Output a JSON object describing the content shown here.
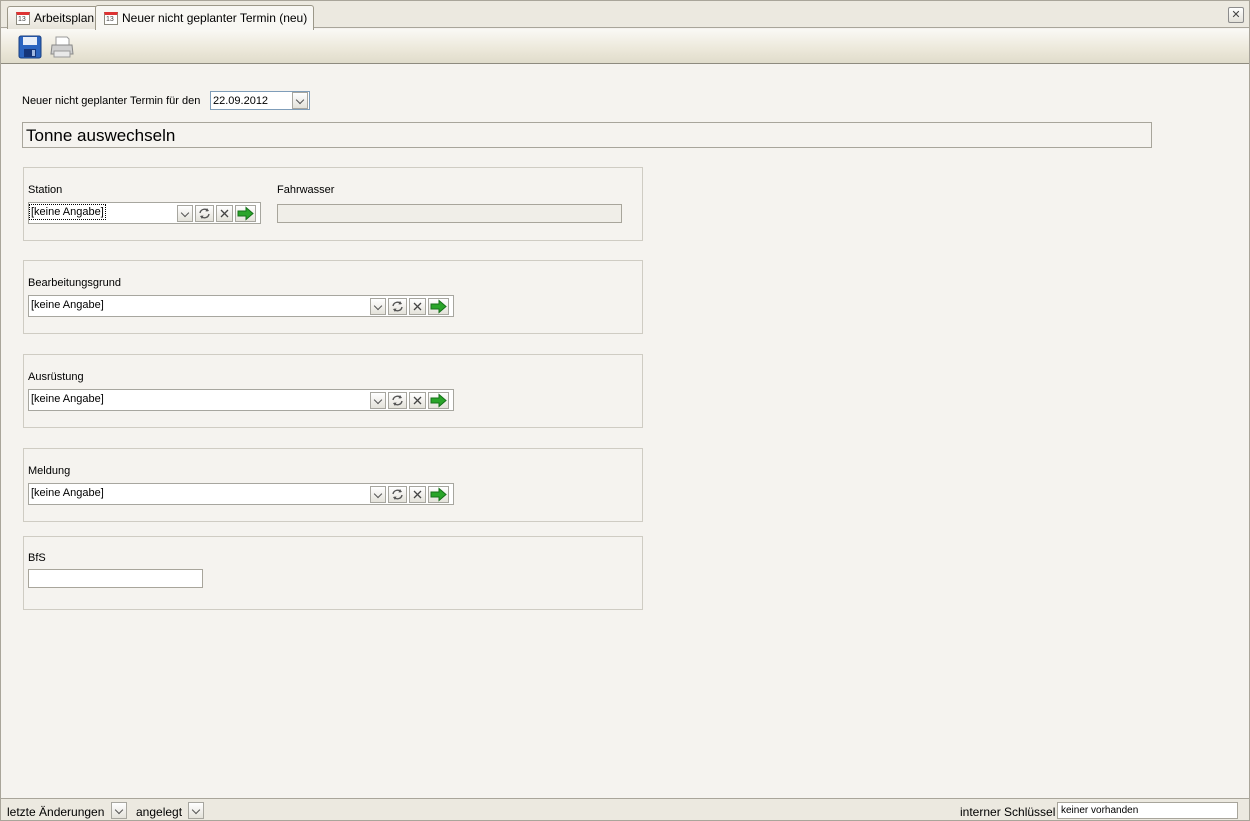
{
  "tabs": [
    {
      "label": "Arbeitsplan",
      "icon": "calendar-icon"
    },
    {
      "label": "Neuer nicht geplanter Termin (neu)",
      "icon": "calendar-icon"
    }
  ],
  "toolbar": {
    "save_icon": "save-icon",
    "print_icon": "printer-icon"
  },
  "form": {
    "date_label": "Neuer nicht geplanter Termin für den",
    "date_value": "22.09.2012",
    "title": "Tonne auswechseln",
    "station": {
      "label": "Station",
      "value": "[keine Angabe]"
    },
    "fahrwasser": {
      "label": "Fahrwasser",
      "value": ""
    },
    "bearbeitungsgrund": {
      "label": "Bearbeitungsgrund",
      "value": "[keine Angabe]"
    },
    "ausruestung": {
      "label": "Ausrüstung",
      "value": "[keine Angabe]"
    },
    "meldung": {
      "label": "Meldung",
      "value": "[keine Angabe]"
    },
    "bfs": {
      "label": "BfS",
      "value": ""
    }
  },
  "statusbar": {
    "last_changes_label": "letzte Änderungen",
    "created_label": "angelegt",
    "internal_key_label": "interner Schlüssel",
    "internal_key_value": "keiner vorhanden"
  },
  "colors": {
    "accent_green": "#2aa52a",
    "save_blue": "#2b64c0"
  }
}
